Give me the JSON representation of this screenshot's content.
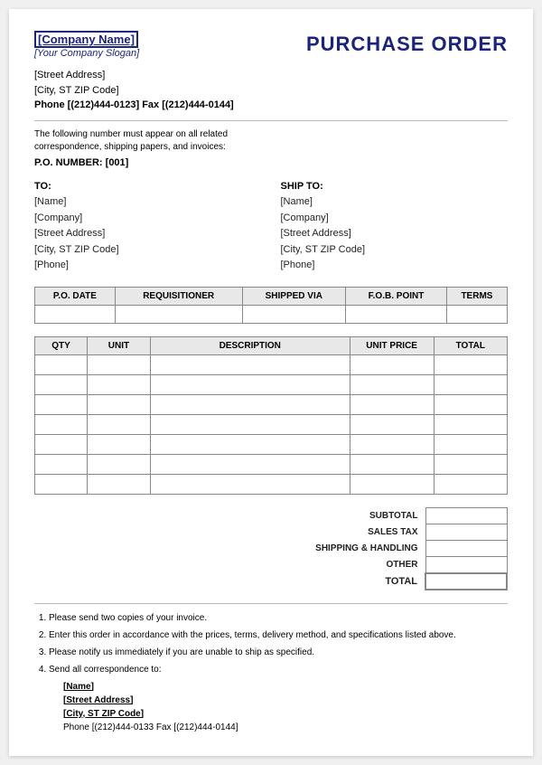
{
  "header": {
    "company_name": "[Company Name]",
    "slogan": "[Your Company Slogan]",
    "title": "PURCHASE ORDER"
  },
  "address": {
    "street": "[Street Address]",
    "city_state_zip": "[City, ST  ZIP Code]",
    "phone_fax": "Phone [(212)444-0123]   Fax [(212)444-0144]"
  },
  "notice": {
    "text": "The following number must appear on all related correspondence, shipping papers, and invoices:",
    "po_number_label": "P.O. NUMBER:",
    "po_number_value": "[001]"
  },
  "to_block": {
    "label": "TO:",
    "name": "[Name]",
    "company": "[Company]",
    "street": "[Street Address]",
    "city": "[City, ST  ZIP Code]",
    "phone": "[Phone]"
  },
  "ship_block": {
    "label": "SHIP TO:",
    "name": "[Name]",
    "company": "[Company]",
    "street": "[Street Address]",
    "city": "[City, ST  ZIP Code]",
    "phone": "[Phone]"
  },
  "info_table": {
    "headers": [
      "P.O. DATE",
      "REQUISITIONER",
      "SHIPPED VIA",
      "F.O.B. POINT",
      "TERMS"
    ]
  },
  "main_table": {
    "headers": [
      "QTY",
      "UNIT",
      "DESCRIPTION",
      "UNIT PRICE",
      "TOTAL"
    ],
    "rows": 7
  },
  "totals": {
    "subtotal_label": "SUBTOTAL",
    "sales_tax_label": "SALES TAX",
    "shipping_label": "SHIPPING & HANDLING",
    "other_label": "OTHER",
    "total_label": "TOTAL"
  },
  "footer": {
    "notes": [
      "Please send two copies of your invoice.",
      "Enter this order in accordance with the prices, terms, delivery method, and specifications  listed above.",
      "Please notify us immediately if you are unable to ship as specified.",
      "Send all correspondence to:"
    ],
    "contact_name": "[Name]",
    "contact_street": "[Street Address]",
    "contact_city": "[City, ST  ZIP Code]",
    "contact_phone_fax": "Phone [(212)444-0133    Fax [(212)444-0144]"
  }
}
